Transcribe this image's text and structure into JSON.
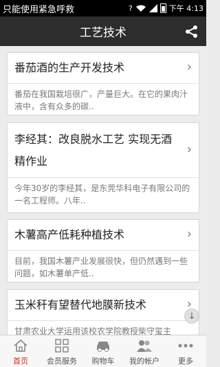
{
  "status_bar": {
    "message": "只能使用紧急呼救",
    "time": "下午 4:13",
    "sim_label": "?"
  },
  "appbar": {
    "title": "工艺技术"
  },
  "articles": [
    {
      "title": "番茄酒的生产开发技术",
      "snippet": "番茄在我国栽培很广，产量巨大。在它的果肉汁液中，含有众多的碳.."
    },
    {
      "title": "李经其：改良脱水工艺 实现无酒精作业",
      "snippet": "今年30岁的李经其，是东莞华科电子有限公司的一名工程师。八年.."
    },
    {
      "title": "木薯高产低耗种植技术",
      "snippet": "目前，我国木薯产业发展很快，但仍然遇到一些问题，如木薯单产低.."
    },
    {
      "title": "玉米秆有望替代地膜新技术",
      "snippet": "甘肃农业大学运用该校农学院教授柴守玺主"
    }
  ],
  "tabbar": {
    "items": [
      {
        "label": "首页",
        "icon": "home-icon",
        "active": true
      },
      {
        "label": "会员服务",
        "icon": "grid-icon",
        "active": false
      },
      {
        "label": "购物车",
        "icon": "car-icon",
        "active": false
      },
      {
        "label": "我的帐户",
        "icon": "users-icon",
        "active": false
      },
      {
        "label": "更多",
        "icon": "more-icon",
        "active": false
      }
    ]
  },
  "colors": {
    "appbar_bg": "#2d2d2d",
    "active_tab": "#c8322a"
  }
}
